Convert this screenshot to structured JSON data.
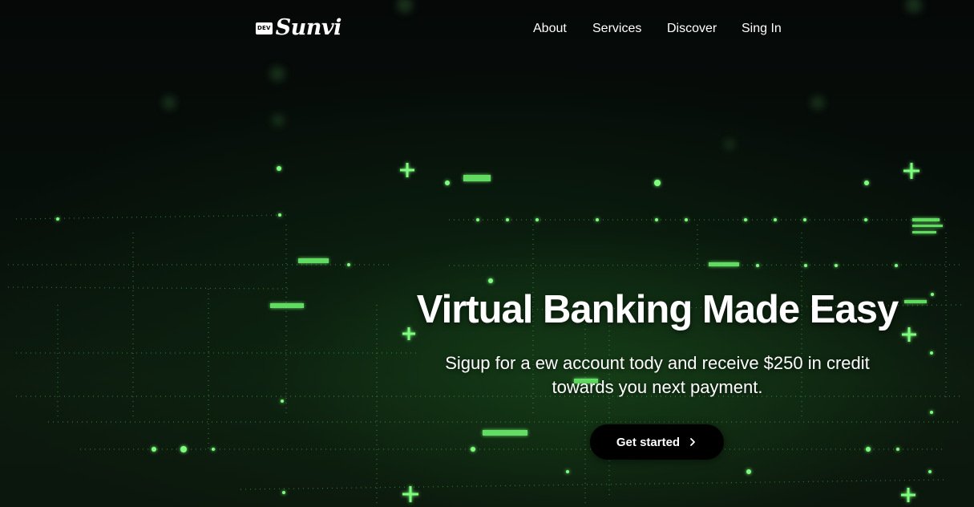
{
  "header": {
    "logo_badge": "DEV",
    "logo_text": "Sunvi",
    "nav": [
      {
        "label": "About"
      },
      {
        "label": "Services"
      },
      {
        "label": "Discover"
      },
      {
        "label": "Sing In"
      }
    ]
  },
  "hero": {
    "title": "Virtual Banking Made Easy",
    "subtitle_line1": "Sigup for a ew account tody and receive $250 in credit",
    "subtitle_line2": "towards you next payment.",
    "cta_label": "Get started",
    "cta_icon": "chevron-right-icon"
  },
  "colors": {
    "background": "#020403",
    "accent_green": "#5fe35f",
    "text": "#ffffff",
    "button": "#000000"
  }
}
